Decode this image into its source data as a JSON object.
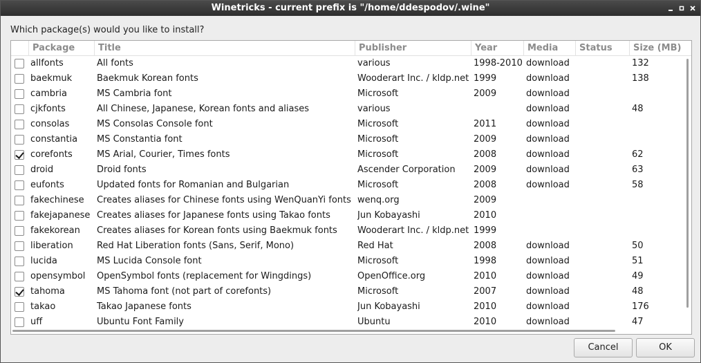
{
  "window": {
    "title": "Winetricks - current prefix is \"/home/ddespodov/.wine\"",
    "controls": {
      "minimize": "minimize-icon",
      "maximize": "maximize-icon",
      "close": "close-icon"
    }
  },
  "prompt": "Which package(s) would you like to install?",
  "table": {
    "headers": [
      "Package",
      "Title",
      "Publisher",
      "Year",
      "Media",
      "Status",
      "Size (MB)"
    ],
    "rows": [
      {
        "checked": false,
        "package": "allfonts",
        "title": "All fonts",
        "publisher": "various",
        "year": "1998-2010",
        "media": "download",
        "status": "",
        "size": "132"
      },
      {
        "checked": false,
        "package": "baekmuk",
        "title": "Baekmuk Korean fonts",
        "publisher": "Wooderart Inc. / kldp.net",
        "year": "1999",
        "media": "download",
        "status": "",
        "size": "138"
      },
      {
        "checked": false,
        "package": "cambria",
        "title": "MS Cambria font",
        "publisher": "Microsoft",
        "year": "2009",
        "media": "download",
        "status": "",
        "size": ""
      },
      {
        "checked": false,
        "package": "cjkfonts",
        "title": "All Chinese, Japanese, Korean fonts and aliases",
        "publisher": "various",
        "year": "",
        "media": "download",
        "status": "",
        "size": "48"
      },
      {
        "checked": false,
        "package": "consolas",
        "title": "MS Consolas Console font",
        "publisher": "Microsoft",
        "year": "2011",
        "media": "download",
        "status": "",
        "size": ""
      },
      {
        "checked": false,
        "package": "constantia",
        "title": "MS Constantia font",
        "publisher": "Microsoft",
        "year": "2009",
        "media": "download",
        "status": "",
        "size": ""
      },
      {
        "checked": true,
        "package": "corefonts",
        "title": "MS Arial, Courier, Times fonts",
        "publisher": "Microsoft",
        "year": "2008",
        "media": "download",
        "status": "",
        "size": "62"
      },
      {
        "checked": false,
        "package": "droid",
        "title": "Droid fonts",
        "publisher": "Ascender Corporation",
        "year": "2009",
        "media": "download",
        "status": "",
        "size": "63"
      },
      {
        "checked": false,
        "package": "eufonts",
        "title": "Updated fonts for Romanian and Bulgarian",
        "publisher": "Microsoft",
        "year": "2008",
        "media": "download",
        "status": "",
        "size": "58"
      },
      {
        "checked": false,
        "package": "fakechinese",
        "title": "Creates aliases for Chinese fonts using WenQuanYi fonts",
        "publisher": "wenq.org",
        "year": "2009",
        "media": "",
        "status": "",
        "size": ""
      },
      {
        "checked": false,
        "package": "fakejapanese",
        "title": "Creates aliases for Japanese fonts using Takao fonts",
        "publisher": "Jun Kobayashi",
        "year": "2010",
        "media": "",
        "status": "",
        "size": ""
      },
      {
        "checked": false,
        "package": "fakekorean",
        "title": "Creates aliases for Korean fonts using Baekmuk fonts",
        "publisher": "Wooderart Inc. / kldp.net",
        "year": "1999",
        "media": "",
        "status": "",
        "size": ""
      },
      {
        "checked": false,
        "package": "liberation",
        "title": "Red Hat Liberation fonts (Sans, Serif, Mono)",
        "publisher": "Red Hat",
        "year": "2008",
        "media": "download",
        "status": "",
        "size": "50"
      },
      {
        "checked": false,
        "package": "lucida",
        "title": "MS Lucida Console font",
        "publisher": "Microsoft",
        "year": "1998",
        "media": "download",
        "status": "",
        "size": "51"
      },
      {
        "checked": false,
        "package": "opensymbol",
        "title": "OpenSymbol fonts (replacement for Wingdings)",
        "publisher": "OpenOffice.org",
        "year": "2010",
        "media": "download",
        "status": "",
        "size": "49"
      },
      {
        "checked": true,
        "package": "tahoma",
        "title": "MS Tahoma font (not part of corefonts)",
        "publisher": "Microsoft",
        "year": "2007",
        "media": "download",
        "status": "",
        "size": "48"
      },
      {
        "checked": false,
        "package": "takao",
        "title": "Takao Japanese fonts",
        "publisher": "Jun Kobayashi",
        "year": "2010",
        "media": "download",
        "status": "",
        "size": "176"
      },
      {
        "checked": false,
        "package": "uff",
        "title": "Ubuntu Font Family",
        "publisher": "Ubuntu",
        "year": "2010",
        "media": "download",
        "status": "",
        "size": "47"
      }
    ]
  },
  "buttons": {
    "cancel": "Cancel",
    "ok": "OK"
  }
}
